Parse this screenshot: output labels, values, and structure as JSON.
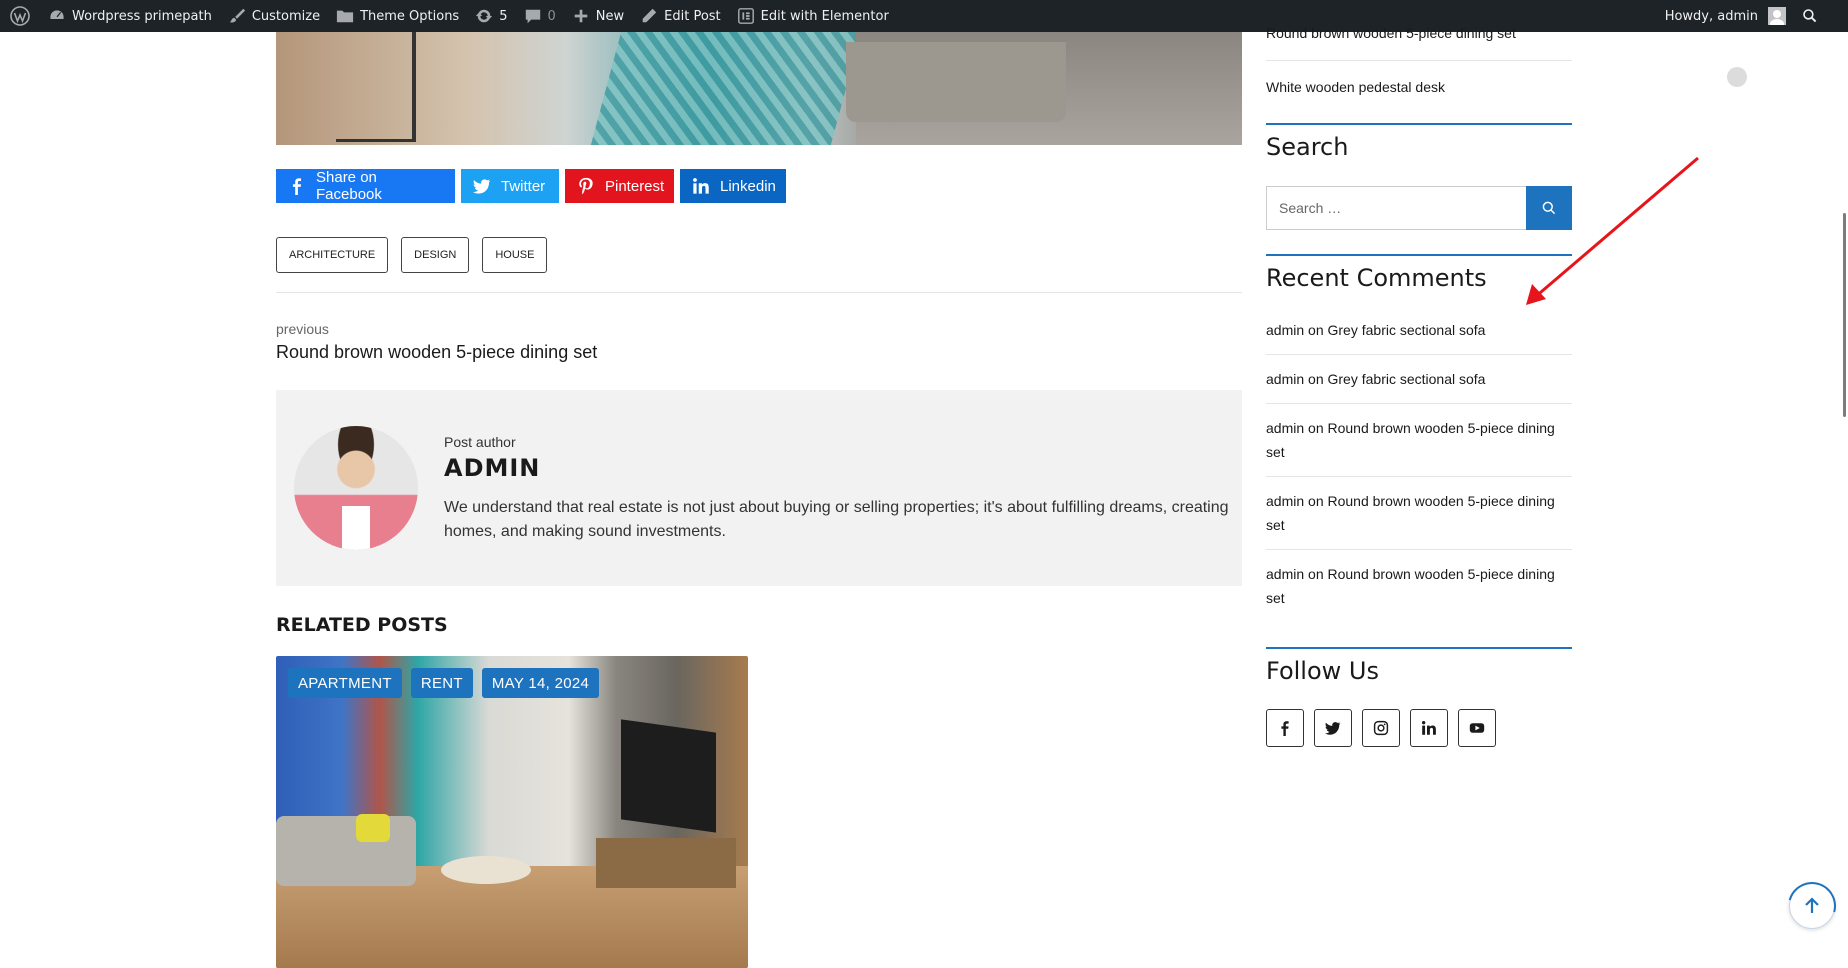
{
  "adminbar": {
    "site_name": "Wordpress primepath",
    "customize": "Customize",
    "theme_options": "Theme Options",
    "updates_count": "5",
    "comments_count": "0",
    "new": "New",
    "edit_post": "Edit Post",
    "edit_elementor": "Edit with Elementor",
    "howdy": "Howdy, admin"
  },
  "share": {
    "facebook": "Share on Facebook",
    "twitter": "Twitter",
    "pinterest": "Pinterest",
    "linkedin": "Linkedin"
  },
  "tags": [
    "ARCHITECTURE",
    "DESIGN",
    "HOUSE"
  ],
  "navigation": {
    "previous_label": "previous",
    "previous_title": "Round brown wooden 5-piece dining set"
  },
  "author": {
    "label": "Post author",
    "name": "ADMIN",
    "bio": "We understand that real estate is not just about buying or selling properties; it's about fulfilling dreams, creating homes, and making sound investments."
  },
  "related": {
    "title": "RELATED POSTS",
    "badges": [
      "APARTMENT",
      "RENT",
      "MAY 14, 2024"
    ]
  },
  "sidebar": {
    "recent_posts": [
      "Round brown wooden 5-piece dining set",
      "White wooden pedestal desk"
    ],
    "search": {
      "title": "Search",
      "placeholder": "Search …"
    },
    "recent_comments": {
      "title": "Recent Comments",
      "items": [
        {
          "author": "admin",
          "on": "on",
          "post": "Grey fabric sectional sofa"
        },
        {
          "author": "admin",
          "on": "on",
          "post": "Grey fabric sectional sofa"
        },
        {
          "author": "admin",
          "on": "on",
          "post": "Round brown wooden 5-piece dining set"
        },
        {
          "author": "admin",
          "on": "on",
          "post": "Round brown wooden 5-piece dining set"
        },
        {
          "author": "admin",
          "on": "on",
          "post": "Round brown wooden 5-piece dining set"
        }
      ]
    },
    "follow": {
      "title": "Follow Us",
      "icons": [
        "facebook-icon",
        "twitter-icon",
        "instagram-icon",
        "linkedin-icon",
        "youtube-icon"
      ]
    }
  },
  "colors": {
    "accent": "#1e73be",
    "adminbar": "#1d2327",
    "facebook": "#1877f2",
    "twitter": "#1da1f2",
    "pinterest": "#e2141e",
    "linkedin": "#0a66c2",
    "annotation_arrow": "#e8141c"
  }
}
